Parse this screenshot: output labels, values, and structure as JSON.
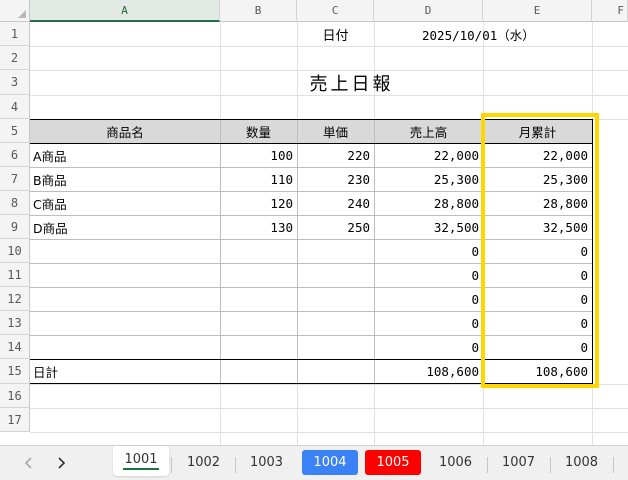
{
  "columns": [
    "A",
    "B",
    "C",
    "D",
    "E",
    "F"
  ],
  "selected_column": "A",
  "rows": [
    "1",
    "2",
    "3",
    "4",
    "5",
    "6",
    "7",
    "8",
    "9",
    "10",
    "11",
    "12",
    "13",
    "14",
    "15",
    "16",
    "17"
  ],
  "date_label": "日付",
  "date_value": "2025/10/01（水）",
  "report_title": "売上日報",
  "table": {
    "headers": [
      "商品名",
      "数量",
      "単価",
      "売上高",
      "月累計"
    ],
    "items": [
      {
        "name": "A商品",
        "qty": "100",
        "price": "220",
        "sales": "22,000",
        "cumulative": "22,000"
      },
      {
        "name": "B商品",
        "qty": "110",
        "price": "230",
        "sales": "25,300",
        "cumulative": "25,300"
      },
      {
        "name": "C商品",
        "qty": "120",
        "price": "240",
        "sales": "28,800",
        "cumulative": "28,800"
      },
      {
        "name": "D商品",
        "qty": "130",
        "price": "250",
        "sales": "32,500",
        "cumulative": "32,500"
      },
      {
        "name": "",
        "qty": "",
        "price": "",
        "sales": "0",
        "cumulative": "0"
      },
      {
        "name": "",
        "qty": "",
        "price": "",
        "sales": "0",
        "cumulative": "0"
      },
      {
        "name": "",
        "qty": "",
        "price": "",
        "sales": "0",
        "cumulative": "0"
      },
      {
        "name": "",
        "qty": "",
        "price": "",
        "sales": "0",
        "cumulative": "0"
      },
      {
        "name": "",
        "qty": "",
        "price": "",
        "sales": "0",
        "cumulative": "0"
      }
    ],
    "total": {
      "name": "日計",
      "sales": "108,600",
      "cumulative": "108,600"
    }
  },
  "highlight_color": "#ffd700",
  "sheet_nav": {
    "prev_icon": "chevron-left-icon",
    "next_icon": "chevron-right-icon"
  },
  "tabs": [
    {
      "label": "1001",
      "active": true,
      "color": ""
    },
    {
      "label": "1002",
      "active": false,
      "color": ""
    },
    {
      "label": "1003",
      "active": false,
      "color": ""
    },
    {
      "label": "1004",
      "active": false,
      "color": "#3b82f6"
    },
    {
      "label": "1005",
      "active": false,
      "color": "#ff0000"
    },
    {
      "label": "1006",
      "active": false,
      "color": ""
    },
    {
      "label": "1007",
      "active": false,
      "color": ""
    },
    {
      "label": "1008",
      "active": false,
      "color": ""
    }
  ]
}
